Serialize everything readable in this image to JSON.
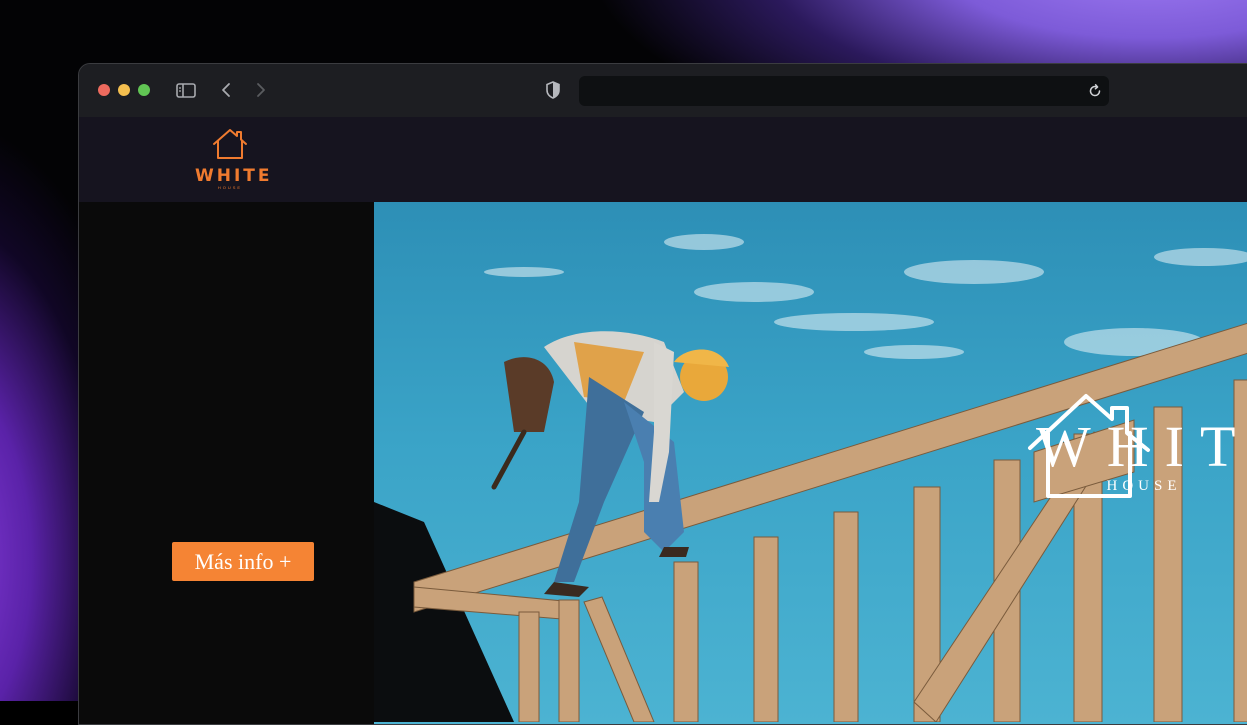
{
  "site": {
    "logo_word": "WHITE",
    "logo_sub": "HOUSE",
    "brand_color": "#f07b2f"
  },
  "hero": {
    "cta_label": "Más info +",
    "cta_color": "#f58434",
    "logo_word": "WHITE",
    "logo_sub": "HOUSE"
  },
  "browser": {
    "icons": [
      "sidebar-icon",
      "back-icon",
      "forward-icon",
      "shield-icon",
      "reload-icon"
    ]
  }
}
